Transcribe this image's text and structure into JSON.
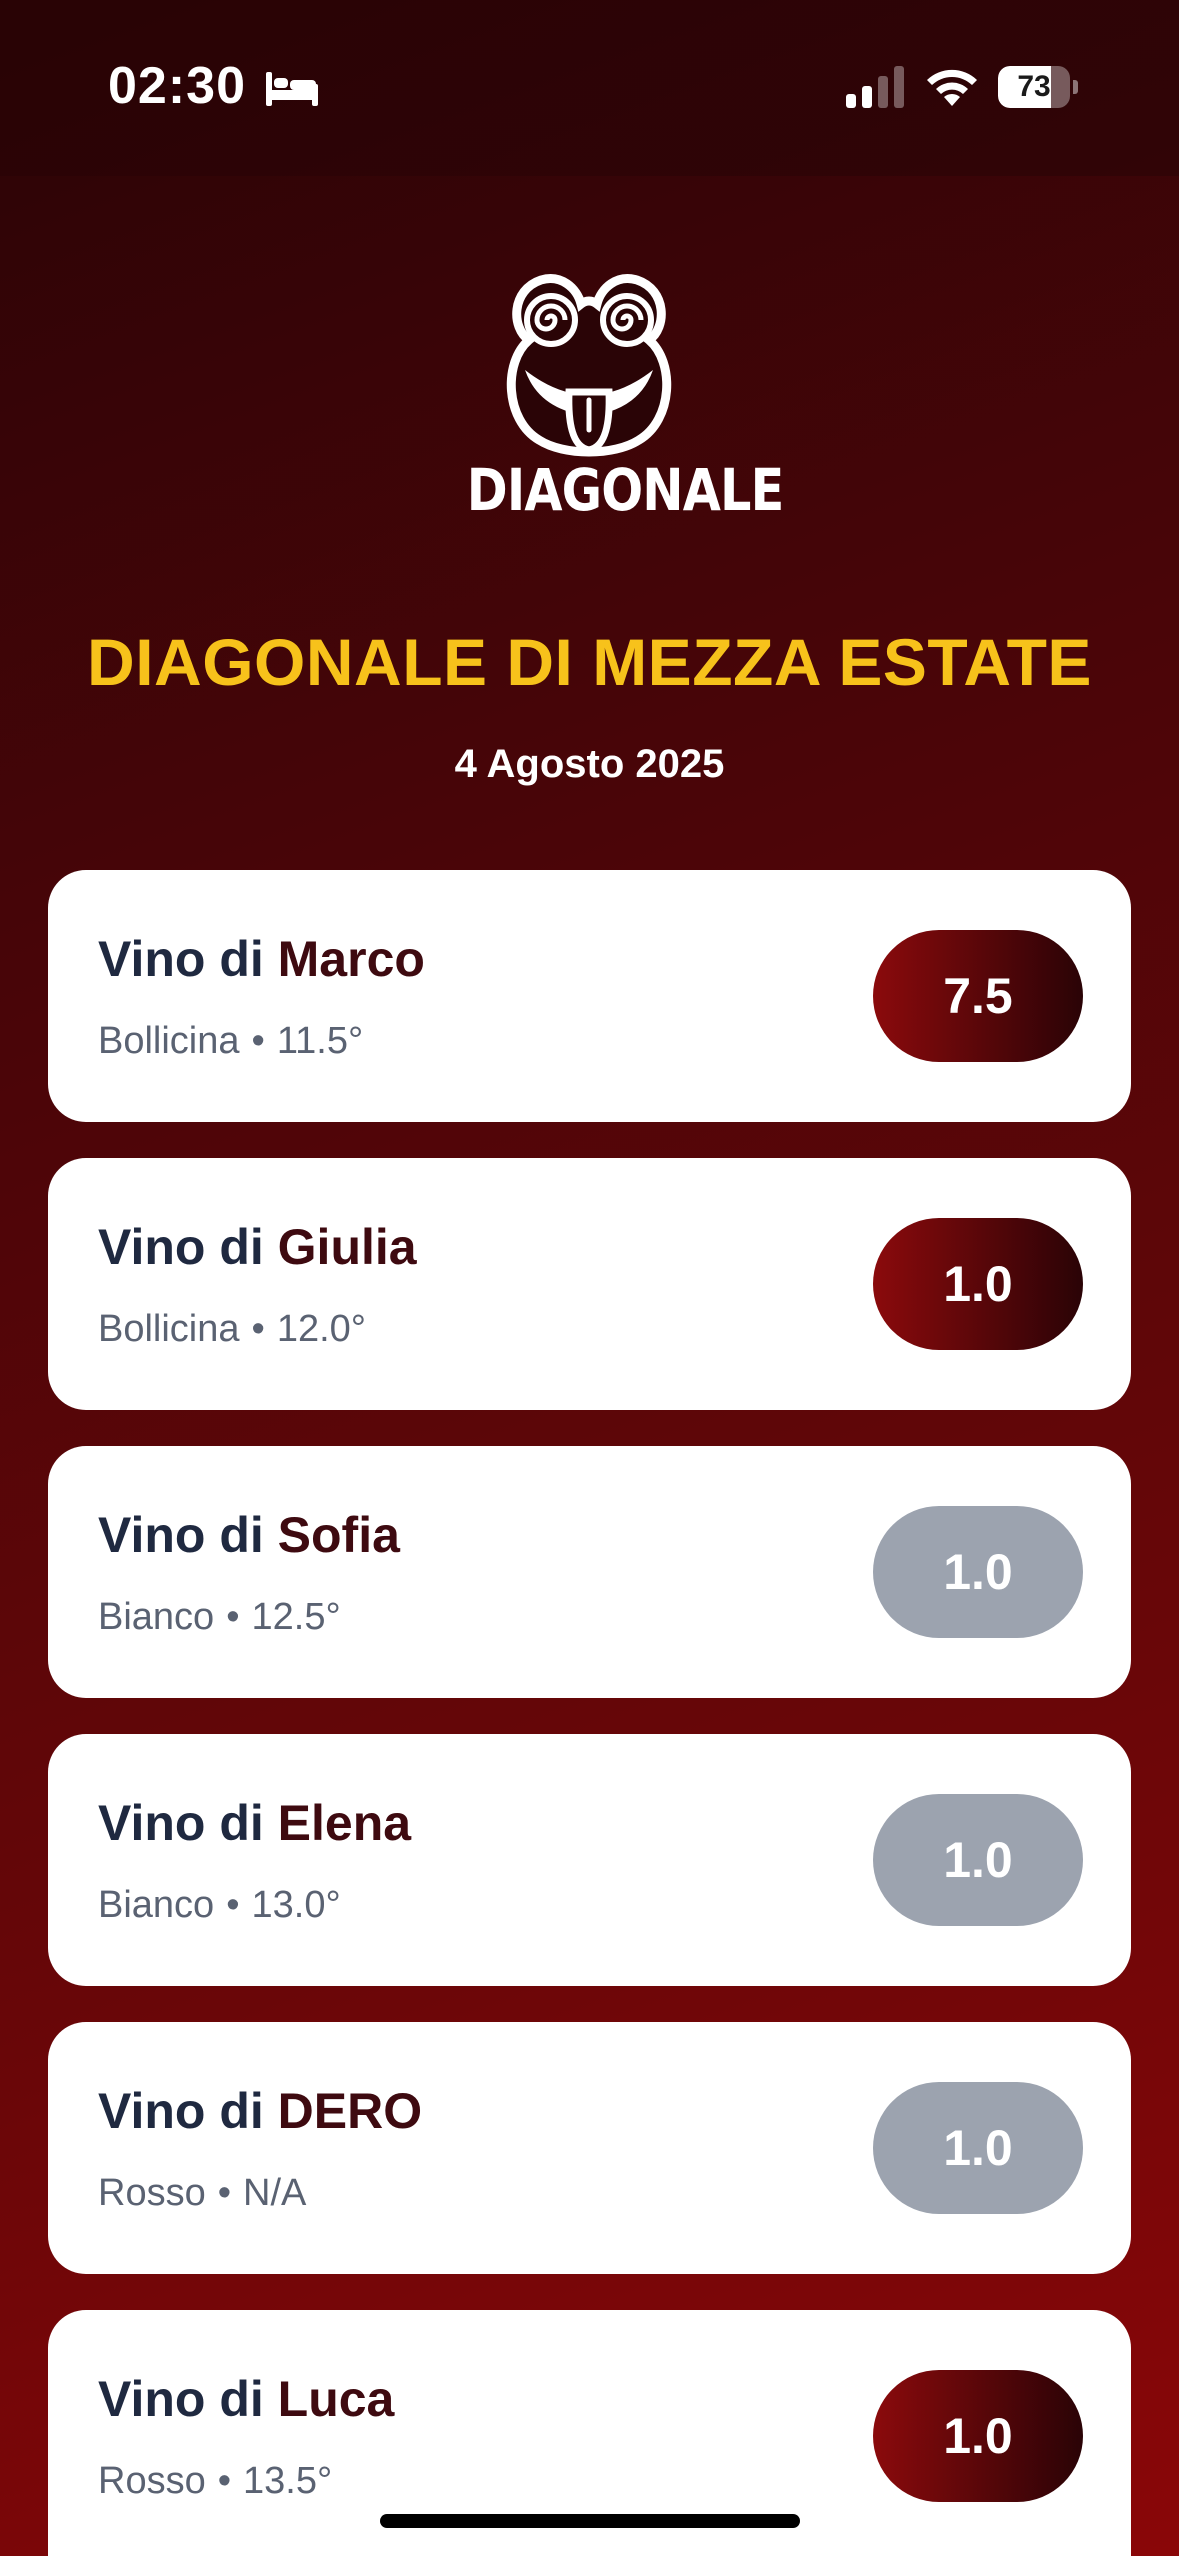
{
  "status_bar": {
    "time": "02:30",
    "battery": "73",
    "battery_level": 0.73,
    "icons": [
      "bed-icon",
      "cellular-signal-icon",
      "wifi-icon",
      "battery-icon"
    ]
  },
  "logo": {
    "text": "DIAGONALE",
    "icon": "frog-face-icon"
  },
  "event": {
    "title": "DIAGONALE DI MEZZA ESTATE",
    "date": "4 Agosto 2025"
  },
  "colors": {
    "accent_yellow": "#f7c21b",
    "score_active_start": "#8b0a0c",
    "score_active_end": "#2a0306",
    "score_inactive": "#9ca3af"
  },
  "wines": [
    {
      "prefix": "Vino di",
      "owner": "Marco",
      "type": "Bollicina",
      "separator": "•",
      "abv": "11.5°",
      "score": "7.5",
      "active": true
    },
    {
      "prefix": "Vino di",
      "owner": "Giulia",
      "type": "Bollicina",
      "separator": "•",
      "abv": "12.0°",
      "score": "1.0",
      "active": true
    },
    {
      "prefix": "Vino di",
      "owner": "Sofia",
      "type": "Bianco",
      "separator": "•",
      "abv": "12.5°",
      "score": "1.0",
      "active": false
    },
    {
      "prefix": "Vino di",
      "owner": "Elena",
      "type": "Bianco",
      "separator": "•",
      "abv": "13.0°",
      "score": "1.0",
      "active": false
    },
    {
      "prefix": "Vino di",
      "owner": "DERO",
      "type": "Rosso",
      "separator": "•",
      "abv": "N/A",
      "score": "1.0",
      "active": false
    },
    {
      "prefix": "Vino di",
      "owner": "Luca",
      "type": "Rosso",
      "separator": "•",
      "abv": "13.5°",
      "score": "1.0",
      "active": true
    }
  ]
}
